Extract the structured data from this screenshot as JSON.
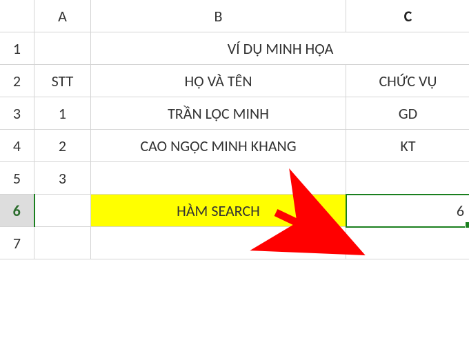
{
  "columns": {
    "a": "A",
    "b": "B",
    "c": "C"
  },
  "rows": {
    "r1": "1",
    "r2": "2",
    "r3": "3",
    "r4": "4",
    "r5": "5",
    "r6": "6",
    "r7": "7"
  },
  "cells": {
    "r1": {
      "merged_bc": "VÍ DỤ MINH HỌA"
    },
    "r2": {
      "a": "STT",
      "b": "HỌ VÀ TÊN",
      "c": "CHỨC VỤ"
    },
    "r3": {
      "a": "1",
      "b": "TRẦN LỘC MINH",
      "c": "GD"
    },
    "r4": {
      "a": "2",
      "b": "CAO NGỌC MINH KHANG",
      "c": "KT"
    },
    "r5": {
      "a": "3",
      "b": "",
      "c": ""
    },
    "r6": {
      "a": "",
      "b": "HÀM SEARCH",
      "c": "6"
    },
    "r7": {
      "a": "",
      "b": "",
      "c": ""
    }
  },
  "chart_data": {
    "type": "table",
    "title": "VÍ DỤ MINH HỌA",
    "columns": [
      "STT",
      "HỌ VÀ TÊN",
      "CHỨC VỤ"
    ],
    "rows": [
      {
        "STT": 1,
        "HỌ VÀ TÊN": "TRẦN LỘC MINH",
        "CHỨC VỤ": "GD"
      },
      {
        "STT": 2,
        "HỌ VÀ TÊN": "CAO NGỌC MINH KHANG",
        "CHỨC VỤ": "KT"
      },
      {
        "STT": 3,
        "HỌ VÀ TÊN": "",
        "CHỨC VỤ": ""
      }
    ],
    "footer": {
      "label": "HÀM SEARCH",
      "result": 6
    }
  }
}
